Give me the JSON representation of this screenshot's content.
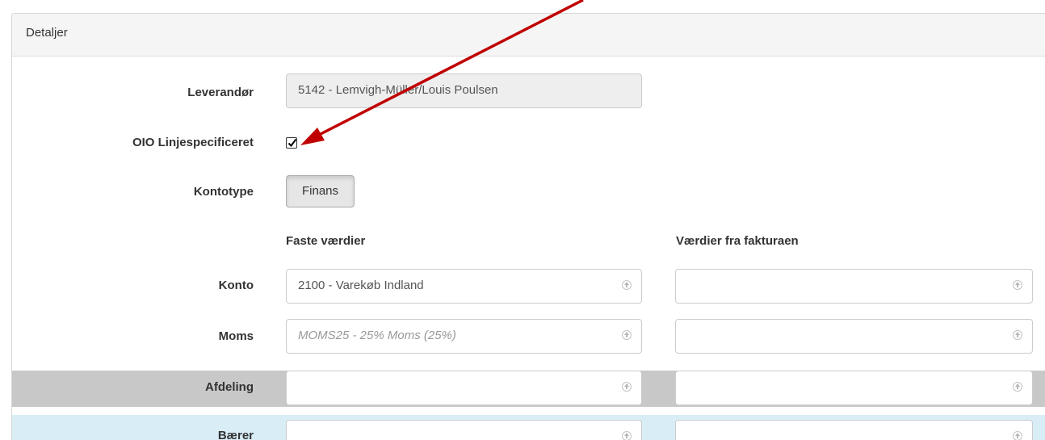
{
  "panel": {
    "title": "Detaljer"
  },
  "form": {
    "supplier": {
      "label": "Leverandør",
      "value": "5142 - Lemvigh-Müller/Louis Poulsen"
    },
    "oio": {
      "label": "OIO Linjespecificeret",
      "checked": true
    },
    "account_type": {
      "label": "Kontotype",
      "value": "Finans"
    },
    "columns": {
      "fixed": "Faste værdier",
      "invoice": "Værdier fra fakturaen"
    },
    "rows": [
      {
        "label": "Konto",
        "fixed_value": "2100 - Varekøb Indland",
        "fixed_placeholder": "",
        "invoice_value": ""
      },
      {
        "label": "Moms",
        "fixed_value": "",
        "fixed_placeholder": "MOMS25 - 25% Moms (25%)",
        "invoice_value": ""
      },
      {
        "label": "Afdeling",
        "fixed_value": "",
        "fixed_placeholder": "",
        "invoice_value": ""
      },
      {
        "label": "Bærer",
        "fixed_value": "",
        "fixed_placeholder": "",
        "invoice_value": ""
      }
    ]
  },
  "annotation": {
    "arrow_color": "#c00000"
  },
  "icons": {
    "select": "updown-circle-icon",
    "check": "checkmark-icon",
    "arrow": "annotation-arrow-icon"
  }
}
